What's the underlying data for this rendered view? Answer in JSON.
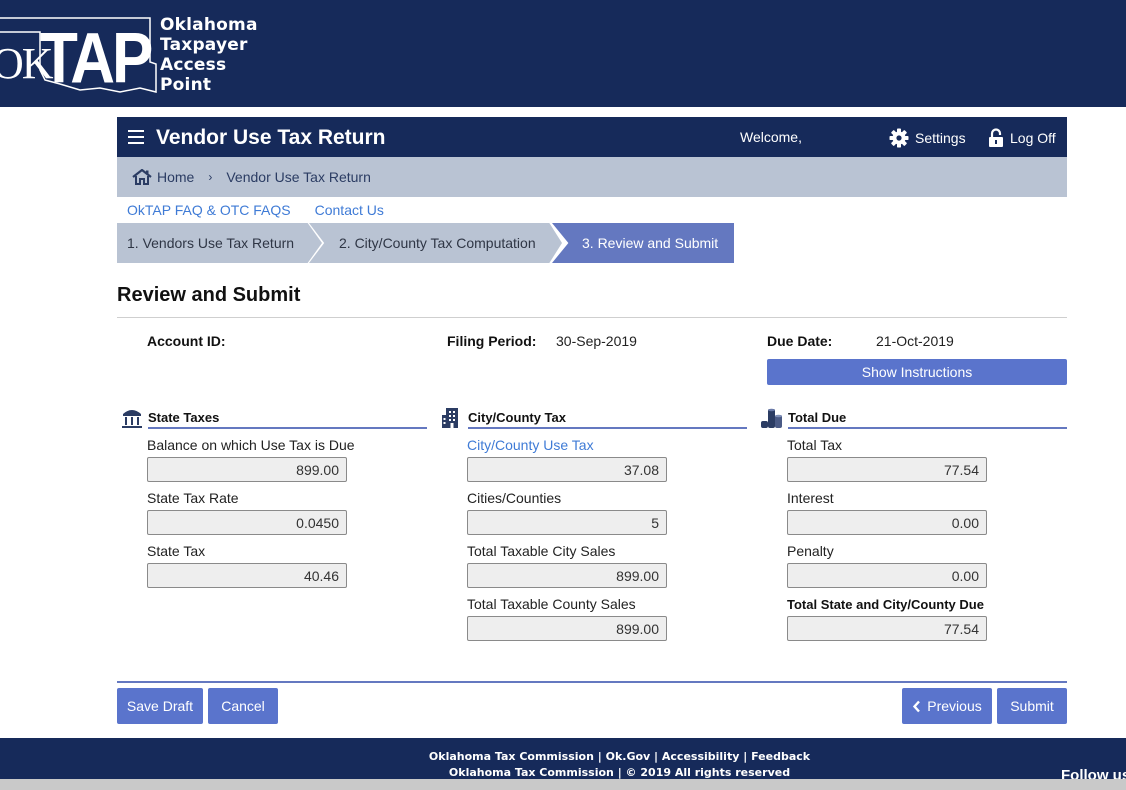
{
  "banner": {
    "logo_ok": "OK",
    "logo_tap": "TAP",
    "logo_words": [
      "Oklahoma",
      "Taxpayer",
      "Access",
      "Point"
    ]
  },
  "header": {
    "title": "Vendor Use Tax Return",
    "welcome": "Welcome,",
    "settings_label": "Settings",
    "logoff_label": "Log Off"
  },
  "breadcrumb": {
    "home": "Home",
    "separator": "›",
    "current": "Vendor Use Tax Return"
  },
  "links": {
    "faq": "OkTAP FAQ & OTC FAQS",
    "contact": "Contact Us"
  },
  "steps": [
    {
      "label": "1. Vendors Use Tax Return",
      "active": false
    },
    {
      "label": "2. City/County Tax Computation",
      "active": false
    },
    {
      "label": "3. Review and Submit",
      "active": true
    }
  ],
  "section": {
    "title": "Review and Submit"
  },
  "meta": {
    "account_id_label": "Account ID:",
    "account_id_value": "",
    "filing_period_label": "Filing Period:",
    "filing_period_value": "30-Sep-2019",
    "due_date_label": "Due Date:",
    "due_date_value": "21-Oct-2019",
    "show_instructions": "Show Instructions"
  },
  "state_taxes": {
    "title": "State Taxes",
    "icon": "bank-icon",
    "fields": [
      {
        "label": "Balance on which Use Tax is Due",
        "value": "899.00"
      },
      {
        "label": "State Tax Rate",
        "value": "0.0450"
      },
      {
        "label": "State Tax",
        "value": "40.46"
      }
    ]
  },
  "city_county_tax": {
    "title": "City/County Tax",
    "icon": "building-icon",
    "fields": [
      {
        "label": "City/County Use Tax",
        "value": "37.08"
      },
      {
        "label": "Cities/Counties",
        "value": "5"
      },
      {
        "label": "Total Taxable City Sales",
        "value": "899.00"
      },
      {
        "label": "Total Taxable County Sales",
        "value": "899.00"
      }
    ]
  },
  "total_due": {
    "title": "Total Due",
    "icon": "coins-icon",
    "fields": [
      {
        "label": "Total Tax",
        "value": "77.54"
      },
      {
        "label": "Interest",
        "value": "0.00"
      },
      {
        "label": "Penalty",
        "value": "0.00"
      },
      {
        "label": "Total State and City/County Due",
        "value": "77.54"
      }
    ]
  },
  "buttons": {
    "save_draft": "Save Draft",
    "cancel": "Cancel",
    "previous": "Previous",
    "submit": "Submit"
  },
  "footer": {
    "links": [
      "Oklahoma Tax Commission",
      "Ok.Gov",
      "Accessibility",
      "Feedback"
    ],
    "separator": " | ",
    "copyright": "Oklahoma Tax Commission | © 2019 All rights reserved",
    "follow": "Follow us"
  },
  "colors": {
    "navy": "#162a5a",
    "breadcrumb_bg": "#b9c3d3",
    "active_step": "#6478c0",
    "button": "#5a74cc",
    "link": "#3f7bd6"
  }
}
